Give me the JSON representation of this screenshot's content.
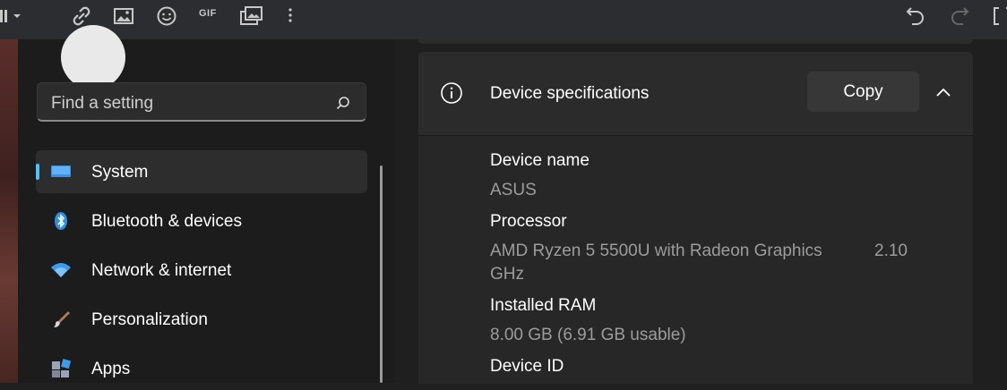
{
  "toolbar": {
    "icons": [
      "menu-icon",
      "link-icon",
      "image-icon",
      "emoji-icon",
      "gif-icon",
      "gallery-icon",
      "more-icon",
      "undo-icon",
      "redo-icon",
      "bracket-icon"
    ],
    "gif_label": "GIF"
  },
  "search": {
    "placeholder": "Find a setting"
  },
  "sidebar": {
    "items": [
      {
        "label": "System",
        "icon": "monitor-icon",
        "selected": true
      },
      {
        "label": "Bluetooth & devices",
        "icon": "bluetooth-icon",
        "selected": false
      },
      {
        "label": "Network & internet",
        "icon": "wifi-icon",
        "selected": false
      },
      {
        "label": "Personalization",
        "icon": "brush-icon",
        "selected": false
      },
      {
        "label": "Apps",
        "icon": "apps-icon",
        "selected": false
      }
    ]
  },
  "specs_card": {
    "title": "Device specifications",
    "copy_label": "Copy",
    "rows": [
      {
        "label": "Device name",
        "value": "ASUS"
      },
      {
        "label": "Processor",
        "value_line1": "AMD Ryzen 5 5500U with Radeon Graphics",
        "value_line1_suffix": "2.10",
        "value_line2": "GHz"
      },
      {
        "label": "Installed RAM",
        "value": "8.00 GB (6.91 GB usable)"
      },
      {
        "label": "Device ID"
      }
    ]
  },
  "colors": {
    "accent": "#4cc2ff",
    "background": "#202020",
    "card": "#2b2b2b"
  }
}
